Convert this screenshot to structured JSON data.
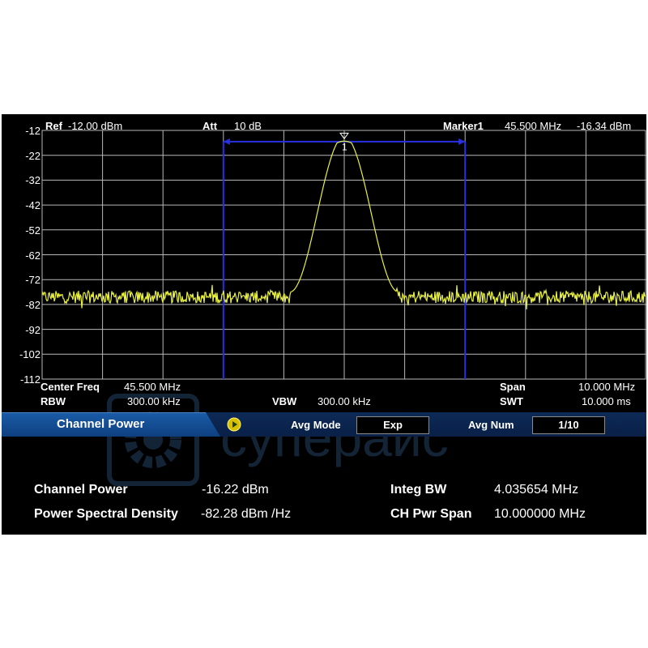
{
  "header": {
    "ref_label": "Ref",
    "ref_value": "-12.00 dBm",
    "att_label": "Att",
    "att_value": "10 dB",
    "marker_label": "Marker1",
    "marker_freq": "45.500 MHz",
    "marker_level": "-16.34 dBm"
  },
  "marker": {
    "number": "1",
    "freq_mhz": 45.5,
    "level_dbm": -16.34
  },
  "y_axis": {
    "ticks": [
      "-12",
      "-22",
      "-32",
      "-42",
      "-52",
      "-62",
      "-72",
      "-82",
      "-92",
      "-102",
      "-112"
    ],
    "min": -112,
    "max": -12
  },
  "x_axis": {
    "start_mhz": 40.5,
    "stop_mhz": 50.5
  },
  "channel": {
    "start_mhz": 43.5,
    "stop_mhz": 47.5
  },
  "trace": {
    "color": "#e8f040",
    "noise_floor_dbm": -79,
    "peak_dbm": -16.34,
    "peak_mhz": 45.5,
    "half_width_mhz": 0.9
  },
  "footer": {
    "center_freq_label": "Center Freq",
    "center_freq_value": "45.500 MHz",
    "rbw_label": "RBW",
    "rbw_value": "300.00 kHz",
    "vbw_label": "VBW",
    "vbw_value": "300.00 kHz",
    "span_label": "Span",
    "span_value": "10.000 MHz",
    "swt_label": "SWT",
    "swt_value": "10.000 ms"
  },
  "mode_bar": {
    "title": "Channel Power",
    "avg_mode_label": "Avg Mode",
    "avg_mode_value": "Exp",
    "avg_num_label": "Avg Num",
    "avg_num_value": "1/10"
  },
  "results": {
    "channel_power_label": "Channel Power",
    "channel_power_value": "-16.22 dBm",
    "psd_label": "Power Spectral Density",
    "psd_value": "-82.28 dBm /Hz",
    "integ_bw_label": "Integ BW",
    "integ_bw_value": "4.035654 MHz",
    "ch_pwr_span_label": "CH Pwr Span",
    "ch_pwr_span_value": "10.000000 MHz"
  },
  "watermark": {
    "text": "суперайс"
  },
  "colors": {
    "grid": "#b8b8b8",
    "channel_lines": "#2830e0",
    "trace": "#e8f040",
    "tab": "#1a5ba6"
  }
}
